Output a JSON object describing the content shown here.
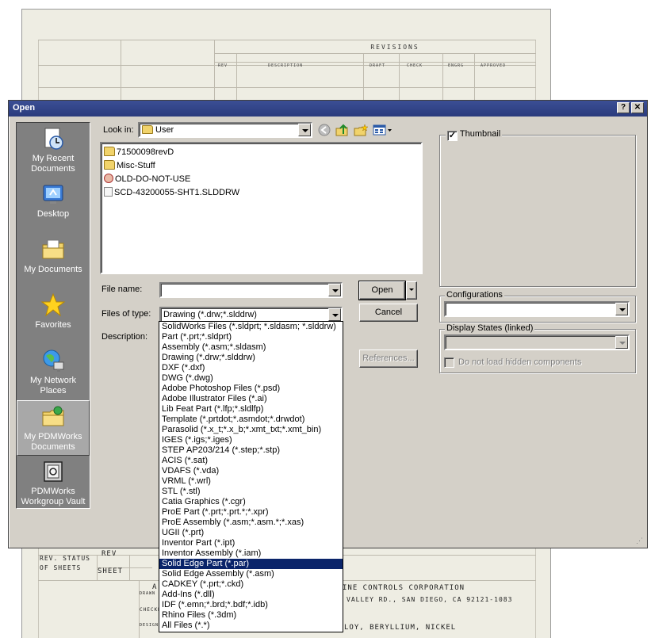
{
  "window": {
    "title": "Open"
  },
  "titlebar_buttons": {
    "help": "?",
    "close": "✕"
  },
  "background_drawing": {
    "revisions_title": "REVISIONS",
    "column_headers": [
      "REV",
      "DESCRIPTION",
      "DRAFT",
      "CHECK",
      "ENGRG",
      "APPROVED"
    ],
    "rev_status": "REV. STATUS",
    "of_sheets": "OF SHEETS",
    "rev": "REV",
    "sheet": "SHEET",
    "drawn": "DRAWN",
    "checked": "CHECKED",
    "design": "DESIGN",
    "company": "INE CONTROLS CORPORATION",
    "address": "VALLEY RD., SAN DIEGO, CA 92121-1083",
    "material": "LOY, BERYLLIUM, NICKEL",
    "left_letter": "A"
  },
  "places_bar": [
    {
      "label": "My Recent Documents",
      "icon": "recent-documents-icon"
    },
    {
      "label": "Desktop",
      "icon": "desktop-icon"
    },
    {
      "label": "My Documents",
      "icon": "my-documents-icon"
    },
    {
      "label": "Favorites",
      "icon": "favorites-star-icon"
    },
    {
      "label": "My Network Places",
      "icon": "network-places-icon"
    },
    {
      "label": "My PDMWorks Documents",
      "icon": "pdmworks-documents-icon"
    },
    {
      "label": "PDMWorks Workgroup Vault",
      "icon": "pdmworks-vault-icon"
    }
  ],
  "look_in": {
    "label": "Look in:",
    "value": "User"
  },
  "files": [
    {
      "name": "71500098revD",
      "type": "folder"
    },
    {
      "name": "Misc-Stuff",
      "type": "folder"
    },
    {
      "name": "OLD-DO-NOT-USE",
      "type": "special"
    },
    {
      "name": "SCD-43200055-SHT1.SLDDRW",
      "type": "drawing"
    }
  ],
  "file_name": {
    "label": "File name:",
    "value": ""
  },
  "files_of_type": {
    "label": "Files of type:",
    "value": "Drawing (*.drw;*.slddrw)"
  },
  "description": {
    "label": "Description:"
  },
  "buttons": {
    "open": "Open",
    "cancel": "Cancel",
    "references": "References..."
  },
  "thumbnail": {
    "label": "Thumbnail",
    "checked": true
  },
  "configurations": {
    "label": "Configurations",
    "value": ""
  },
  "display_states": {
    "label": "Display States (linked)",
    "value": ""
  },
  "hidden_components": {
    "label": "Do not load hidden components",
    "checked": false
  },
  "file_types": [
    "SolidWorks Files (*.sldprt; *.sldasm; *.slddrw)",
    "Part (*.prt;*.sldprt)",
    "Assembly (*.asm;*.sldasm)",
    "Drawing (*.drw;*.slddrw)",
    "DXF (*.dxf)",
    "DWG (*.dwg)",
    "Adobe Photoshop Files (*.psd)",
    "Adobe Illustrator Files (*.ai)",
    "Lib Feat Part (*.lfp;*.sldlfp)",
    "Template (*.prtdot;*.asmdot;*.drwdot)",
    "Parasolid (*.x_t;*.x_b;*.xmt_txt;*.xmt_bin)",
    "IGES (*.igs;*.iges)",
    "STEP AP203/214 (*.step;*.stp)",
    "ACIS (*.sat)",
    "VDAFS (*.vda)",
    "VRML (*.wrl)",
    "STL (*.stl)",
    "Catia Graphics (*.cgr)",
    "ProE Part (*.prt;*.prt.*;*.xpr)",
    "ProE Assembly (*.asm;*.asm.*;*.xas)",
    "UGII (*.prt)",
    "Inventor Part (*.ipt)",
    "Inventor Assembly (*.iam)",
    "Solid Edge Part (*.par)",
    "Solid Edge Assembly (*.asm)",
    "CADKEY (*.prt;*.ckd)",
    "Add-Ins (*.dll)",
    "IDF (*.emn;*.brd;*.bdf;*.idb)",
    "Rhino Files (*.3dm)",
    "All Files (*.*)"
  ],
  "selected_file_type_index": 23,
  "colors": {
    "title_bar": "#2a3b7c",
    "selection": "#0a246a",
    "dialog_face": "#d4d0c8"
  }
}
